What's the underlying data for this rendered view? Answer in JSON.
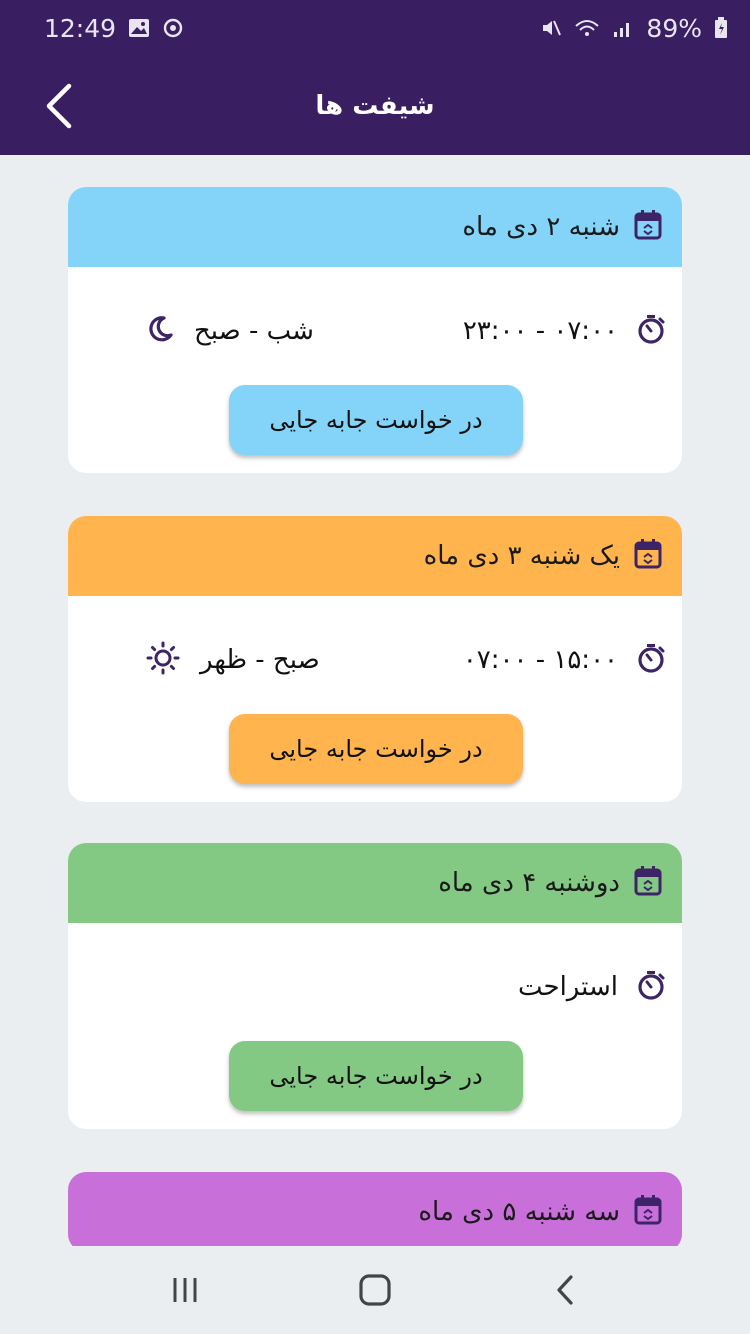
{
  "status_bar": {
    "time": "12:49",
    "battery": "89%",
    "icons_left": [
      "image-icon",
      "sync-icon"
    ],
    "icons_right": [
      "mute-icon",
      "wifi-icon",
      "signal-icon",
      "battery-icon"
    ]
  },
  "app_bar": {
    "title": "شیفت ها",
    "back_icon": "chevron-left-icon"
  },
  "colors": {
    "app_bar": "#3a1e62",
    "icon": "#3d2466",
    "card_1": "#84d4f9",
    "card_2": "#ffb44e",
    "card_3": "#83c983",
    "card_4": "#c86fd9"
  },
  "shifts": [
    {
      "date": "شنبه ۲ دی ماه",
      "time": "۰۷:۰۰ - ۲۳:۰۰",
      "period": "شب - صبح",
      "period_icon": "moon-icon",
      "button_label": "در خواست جابه جایی"
    },
    {
      "date": "یک شنبه ۳ دی ماه",
      "time": "۱۵:۰۰ - ۰۷:۰۰",
      "period": "صبح - ظهر",
      "period_icon": "sun-icon",
      "button_label": "در خواست جابه جایی"
    },
    {
      "date": "دوشنبه ۴ دی ماه",
      "time": "استراحت",
      "period": "",
      "period_icon": "",
      "button_label": "در خواست جابه جایی"
    },
    {
      "date": "سه شنبه ۵ دی ماه"
    }
  ],
  "nav_bar": {
    "buttons": [
      "recents-icon",
      "home-icon",
      "back-icon"
    ]
  }
}
